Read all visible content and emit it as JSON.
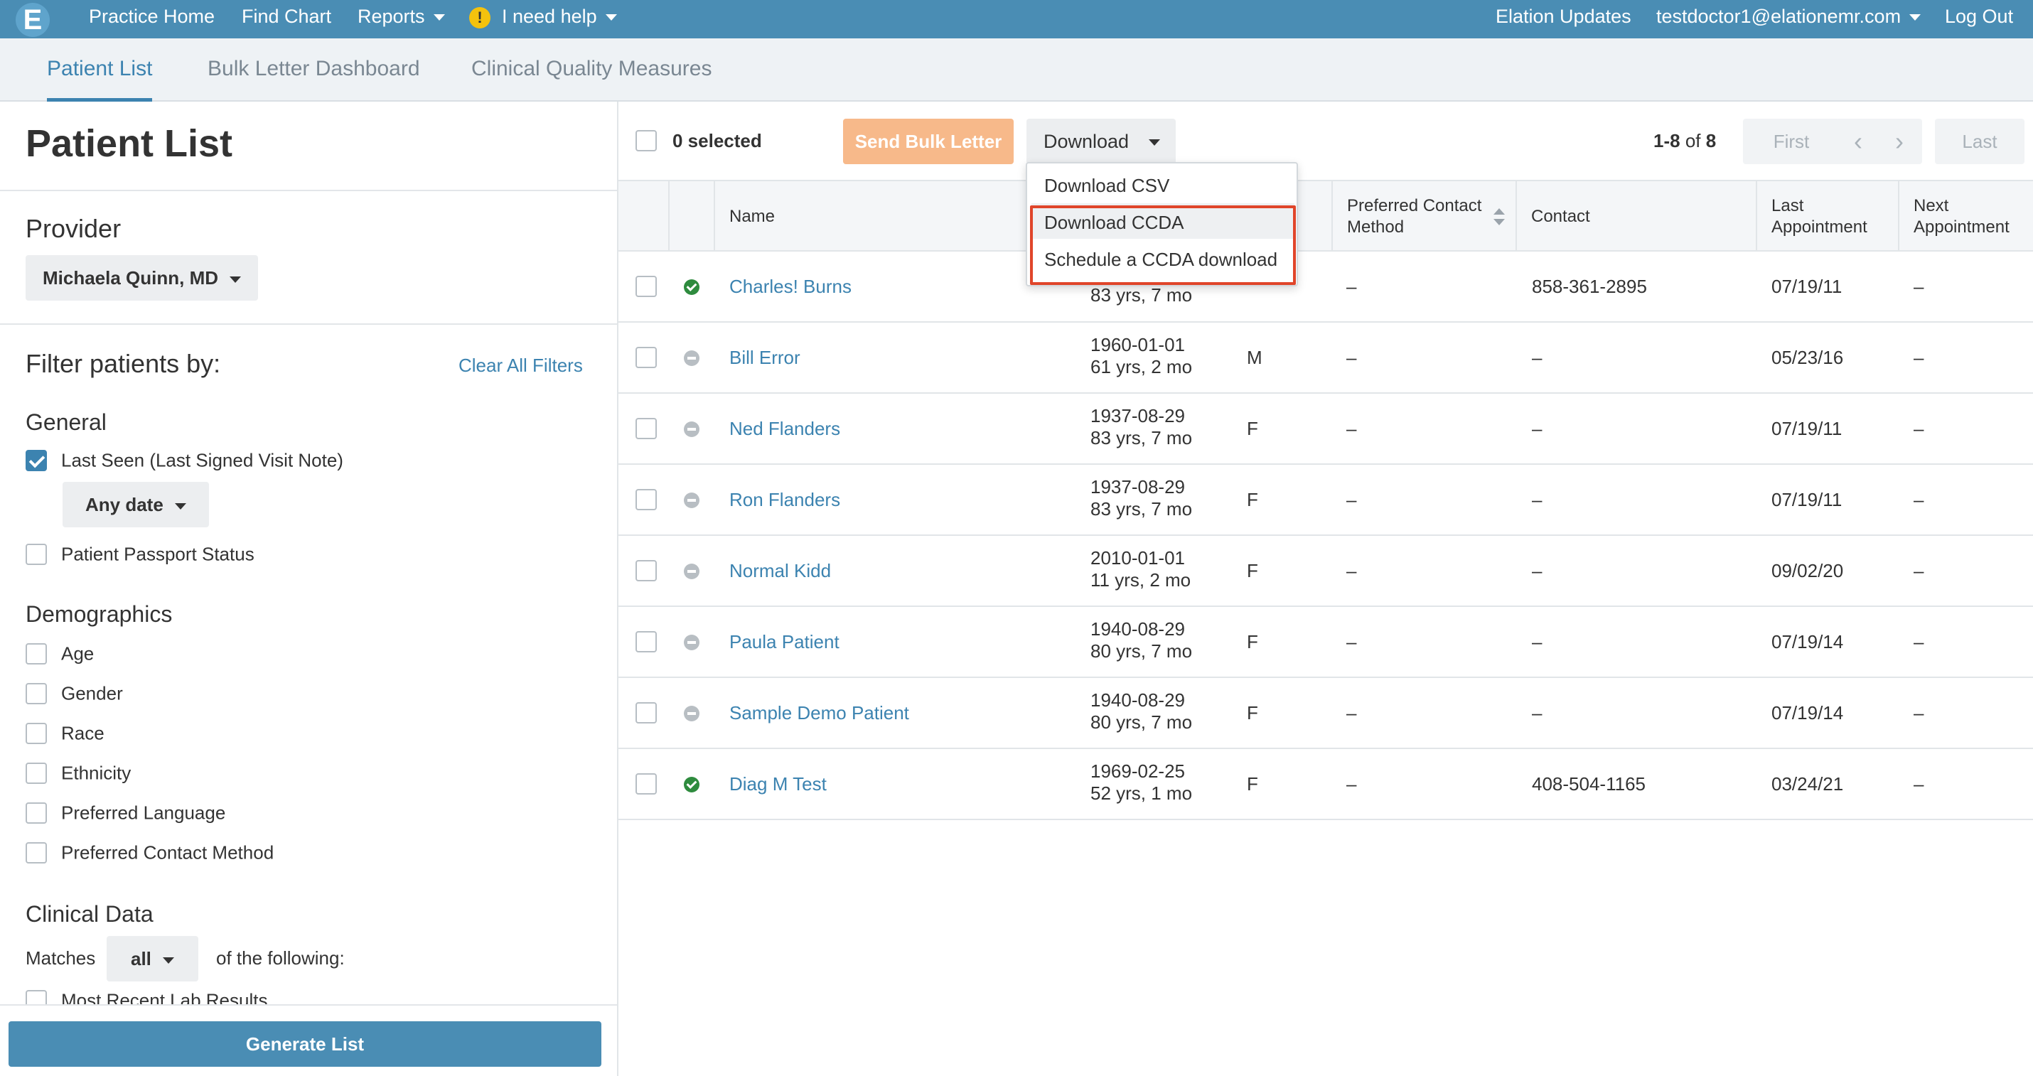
{
  "topnav": {
    "logo": "E",
    "items": [
      "Practice Home",
      "Find Chart",
      "Reports",
      "I need help"
    ],
    "help_icon": "!",
    "right": [
      "Elation Updates",
      "testdoctor1@elationemr.com",
      "Log Out"
    ]
  },
  "subtabs": [
    "Patient List",
    "Bulk Letter Dashboard",
    "Clinical Quality Measures"
  ],
  "sidebar": {
    "title": "Patient List",
    "provider_label": "Provider",
    "provider_value": "Michaela Quinn, MD",
    "filter_label": "Filter patients by:",
    "clear_filters": "Clear All Filters",
    "general_label": "General",
    "last_seen": "Last Seen (Last Signed Visit Note)",
    "date_value": "Any date",
    "passport": "Patient Passport Status",
    "demographics_label": "Demographics",
    "demographics": [
      "Age",
      "Gender",
      "Race",
      "Ethnicity",
      "Preferred Language",
      "Preferred Contact Method"
    ],
    "clinical_label": "Clinical Data",
    "matches_label": "Matches",
    "matches_value": "all",
    "of_following": "of the following:",
    "partial_item": "Most Recent Lab Results",
    "generate": "Generate List"
  },
  "toolbar": {
    "selected": "0 selected",
    "send_bulk": "Send Bulk Letter",
    "download": "Download",
    "range": "1-8",
    "of_label": "of",
    "total": "8",
    "first": "First",
    "prev": "‹",
    "next": "›",
    "last": "Last"
  },
  "table": {
    "headers": {
      "name": "Name",
      "preferred_contact": "Preferred Contact Method",
      "contact": "Contact",
      "last_appt": "Last Appointment",
      "next_appt": "Next Appointment"
    },
    "rows": [
      {
        "status": "active",
        "name": "Charles! Burns",
        "dob": "",
        "age": "83 yrs, 7 mo",
        "sex": "",
        "pref": "–",
        "contact": "858-361-2895",
        "last": "07/19/11",
        "next": "–"
      },
      {
        "status": "inactive",
        "name": "Bill Error",
        "dob": "1960-01-01",
        "age": "61 yrs, 2 mo",
        "sex": "M",
        "pref": "–",
        "contact": "–",
        "last": "05/23/16",
        "next": "–"
      },
      {
        "status": "inactive",
        "name": "Ned Flanders",
        "dob": "1937-08-29",
        "age": "83 yrs, 7 mo",
        "sex": "F",
        "pref": "–",
        "contact": "–",
        "last": "07/19/11",
        "next": "–"
      },
      {
        "status": "inactive",
        "name": "Ron Flanders",
        "dob": "1937-08-29",
        "age": "83 yrs, 7 mo",
        "sex": "F",
        "pref": "–",
        "contact": "–",
        "last": "07/19/11",
        "next": "–"
      },
      {
        "status": "inactive",
        "name": "Normal Kidd",
        "dob": "2010-01-01",
        "age": "11 yrs, 2 mo",
        "sex": "F",
        "pref": "–",
        "contact": "–",
        "last": "09/02/20",
        "next": "–"
      },
      {
        "status": "inactive",
        "name": "Paula Patient",
        "dob": "1940-08-29",
        "age": "80 yrs, 7 mo",
        "sex": "F",
        "pref": "–",
        "contact": "–",
        "last": "07/19/14",
        "next": "–"
      },
      {
        "status": "inactive",
        "name": "Sample Demo Patient",
        "dob": "1940-08-29",
        "age": "80 yrs, 7 mo",
        "sex": "F",
        "pref": "–",
        "contact": "–",
        "last": "07/19/14",
        "next": "–"
      },
      {
        "status": "active",
        "name": "Diag M Test",
        "dob": "1969-02-25",
        "age": "52 yrs, 1 mo",
        "sex": "F",
        "pref": "–",
        "contact": "408-504-1165",
        "last": "03/24/21",
        "next": "–"
      }
    ]
  },
  "download_menu": [
    "Download CSV",
    "Download CCDA",
    "Schedule a CCDA download"
  ],
  "colors": {
    "brand": "#4a8db4",
    "link": "#3c83b0",
    "send_button": "#f7b98a",
    "highlight": "#e0452a",
    "active_status": "#2e8b3e"
  }
}
